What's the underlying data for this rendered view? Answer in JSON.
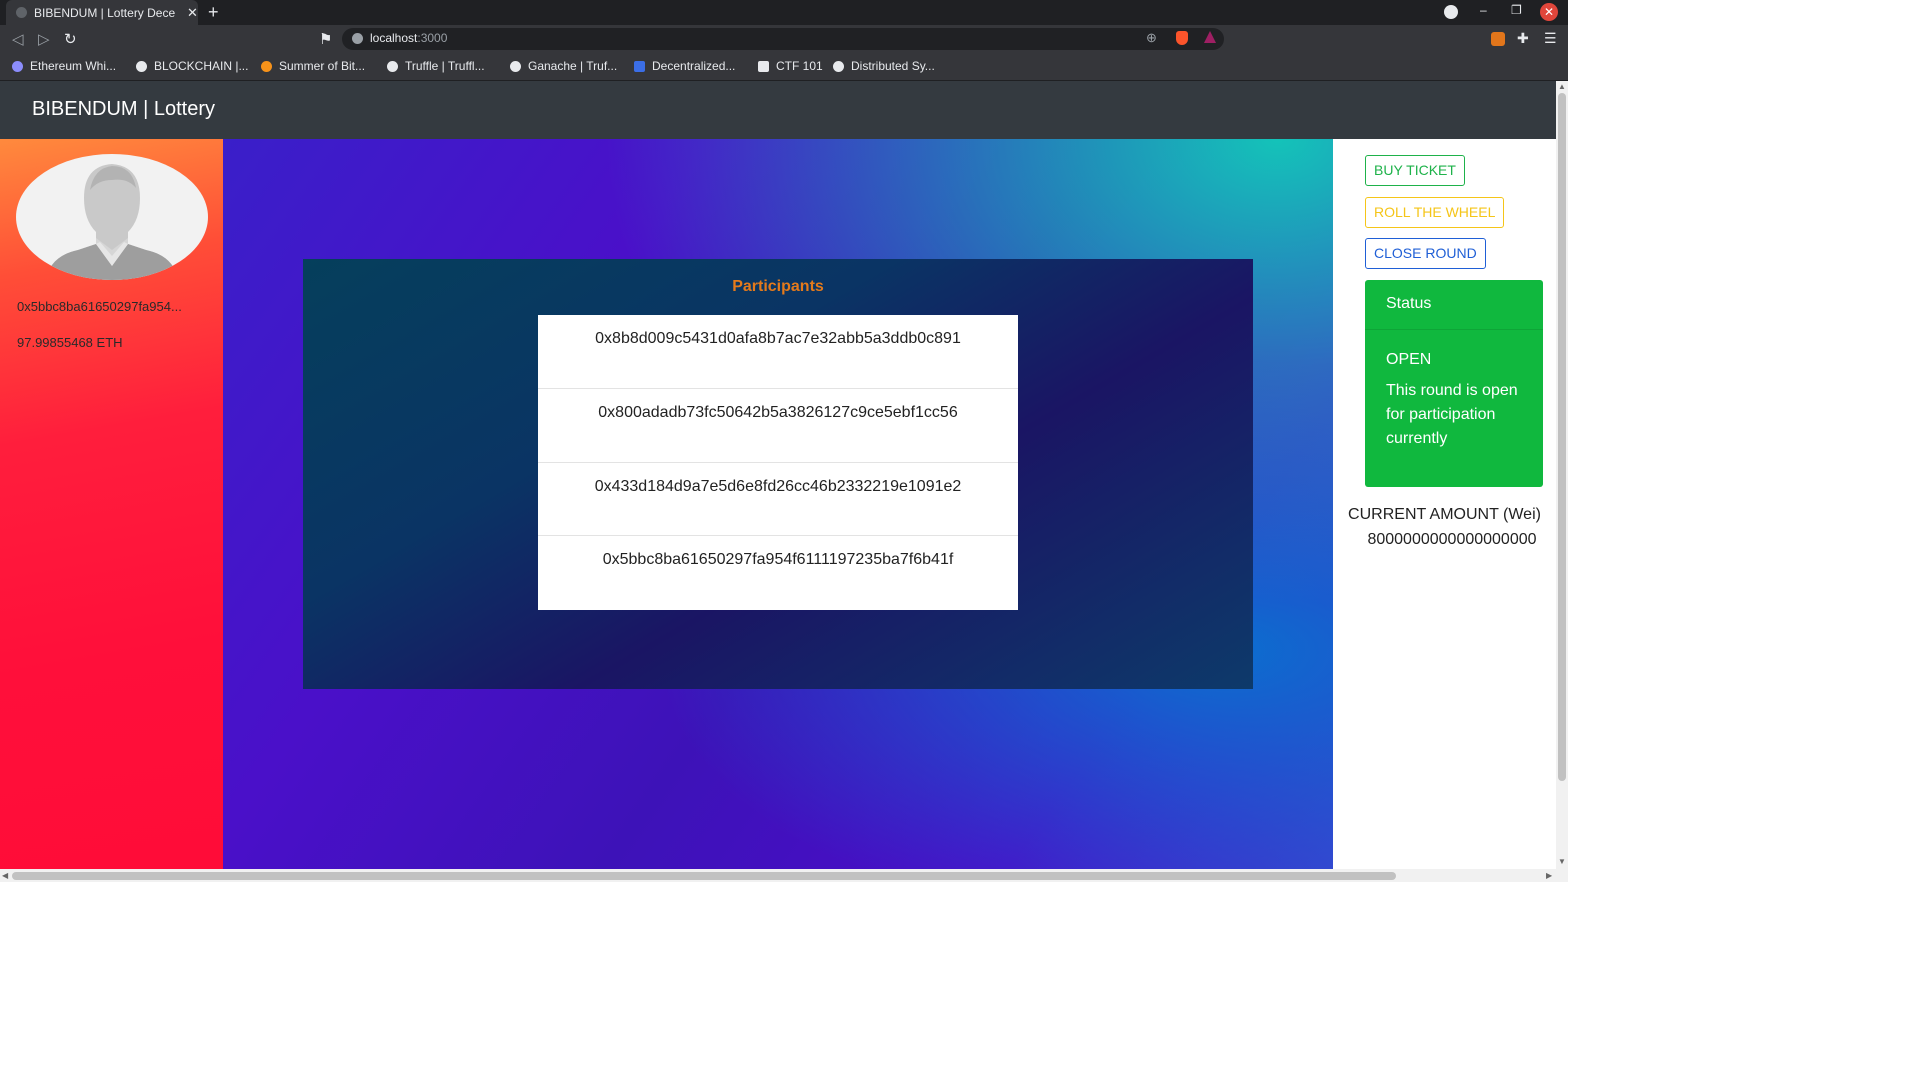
{
  "browser": {
    "tab_title": "BIBENDUM | Lottery Dece",
    "url_host": "localhost",
    "url_port": ":3000",
    "bookmarks": [
      {
        "label": "Ethereum Whi...",
        "color": "#8c8dfc"
      },
      {
        "label": "BLOCKCHAIN |...",
        "color": "#e8eaed"
      },
      {
        "label": "Summer of Bit...",
        "color": "#f7931a"
      },
      {
        "label": "Truffle | Truffl...",
        "color": "#e8eaed"
      },
      {
        "label": "Ganache | Truf...",
        "color": "#e8eaed"
      },
      {
        "label": "Decentralized...",
        "color": "#3b6ee6"
      },
      {
        "label": "CTF 101",
        "color": "#e8eaed"
      },
      {
        "label": "Distributed Sy...",
        "color": "#e8eaed"
      }
    ]
  },
  "header": {
    "brand": "BIBENDUM | Lottery"
  },
  "account": {
    "address": "0x5bbc8ba61650297fa954...",
    "balance": "97.99855468 ETH"
  },
  "participants": {
    "title": "Participants",
    "items": [
      "0x8b8d009c5431d0afa8b7ac7e32abb5a3ddb0c891",
      "0x800adadb73fc50642b5a3826127c9ce5ebf1cc56",
      "0x433d184d9a7e5d6e8fd26cc46b2332219e1091e2",
      "0x5bbc8ba61650297fa954f6111197235ba7f6b41f"
    ]
  },
  "actions": {
    "buy": "BUY TICKET",
    "roll": "ROLL THE WHEEL",
    "close": "CLOSE ROUND"
  },
  "status": {
    "heading": "Status",
    "value": "OPEN",
    "description": "This round is open for participation currently"
  },
  "amount": {
    "label": "CURRENT AMOUNT (Wei)",
    "value": "8000000000000000000"
  },
  "colors": {
    "header_bg": "#343a40",
    "participants_title": "#e47a1b",
    "buy": "#1eb24a",
    "roll": "#f5c518",
    "close": "#1f5fd6",
    "status_bg": "#10b83e"
  }
}
